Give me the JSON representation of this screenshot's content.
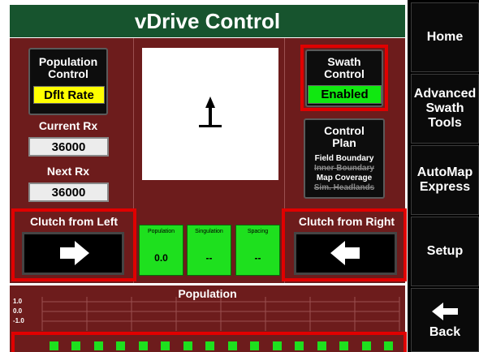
{
  "title": "vDrive Control",
  "population_control": {
    "label_line1": "Population",
    "label_line2": "Control",
    "badge": "Dflt Rate"
  },
  "current_rx": {
    "label": "Current Rx",
    "value": "36000"
  },
  "next_rx": {
    "label": "Next Rx",
    "value": "36000"
  },
  "swath_control": {
    "label_line1": "Swath",
    "label_line2": "Control",
    "badge": "Enabled"
  },
  "control_plan": {
    "label_line1": "Control",
    "label_line2": "Plan",
    "items": [
      {
        "text": "Field Boundary",
        "enabled": true
      },
      {
        "text": "Inner Boundary",
        "enabled": false
      },
      {
        "text": "Map Coverage",
        "enabled": true
      },
      {
        "text": "Sim. Headlands",
        "enabled": false
      }
    ]
  },
  "clutch_left": {
    "label": "Clutch from Left",
    "icon": "arrow-right-icon"
  },
  "clutch_right": {
    "label": "Clutch from Right",
    "icon": "arrow-left-icon"
  },
  "metrics": [
    {
      "label": "Population",
      "value": "0.0"
    },
    {
      "label": "Singulation",
      "value": "--"
    },
    {
      "label": "Spacing",
      "value": "--"
    }
  ],
  "graph": {
    "title": "Population",
    "y_labels": [
      "1.0",
      "0.0",
      "-1.0"
    ],
    "row_units_count": 16
  },
  "sidebar": {
    "home": "Home",
    "advanced_line1": "Advanced",
    "advanced_line2": "Swath",
    "advanced_line3": "Tools",
    "automap_line1": "AutoMap",
    "automap_line2": "Express",
    "setup": "Setup",
    "back": "Back"
  },
  "colors": {
    "panel": "#6d1c1c",
    "title_bar": "#17542e",
    "highlight": "#e00000",
    "status_green": "#1ee01e",
    "status_yellow": "#ffff00"
  }
}
